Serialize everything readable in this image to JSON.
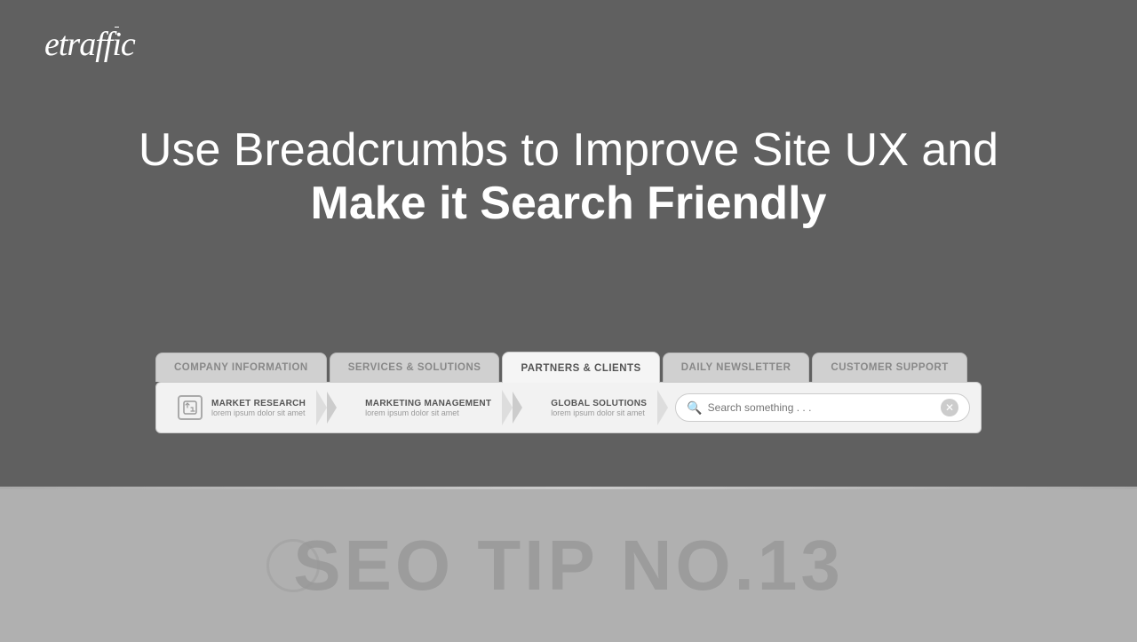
{
  "logo": {
    "text_e": "e",
    "text_traffic": "traff",
    "text_ic": "ic"
  },
  "headline": {
    "line1": "Use Breadcrumbs to Improve Site UX and",
    "line2": "Make it Search Friendly"
  },
  "tabs": [
    {
      "id": "tab-company",
      "label": "COMPANY INFORMATION",
      "active": false
    },
    {
      "id": "tab-services",
      "label": "SERVICES & SOLUTIONS",
      "active": false
    },
    {
      "id": "tab-partners",
      "label": "PARTNERS & CLIENTS",
      "active": true
    },
    {
      "id": "tab-newsletter",
      "label": "DAILY NEWSLETTER",
      "active": false
    },
    {
      "id": "tab-support",
      "label": "CUSTOMER SUPPORT",
      "active": false
    }
  ],
  "breadcrumbs": [
    {
      "id": "bc-market",
      "title": "MARKET RESEARCH",
      "subtitle": "lorem ipsum dolor sit amet",
      "has_icon": true
    },
    {
      "id": "bc-marketing",
      "title": "MARKETING MANAGEMENT",
      "subtitle": "lorem ipsum dolor sit amet",
      "has_icon": false
    },
    {
      "id": "bc-global",
      "title": "GLOBAL SOLUTIONS",
      "subtitle": "lorem ipsum dolor sit amet",
      "has_icon": false
    }
  ],
  "search": {
    "placeholder": "Search something . . ."
  },
  "seo_tip": {
    "text": "SEO TIP NO.13"
  }
}
